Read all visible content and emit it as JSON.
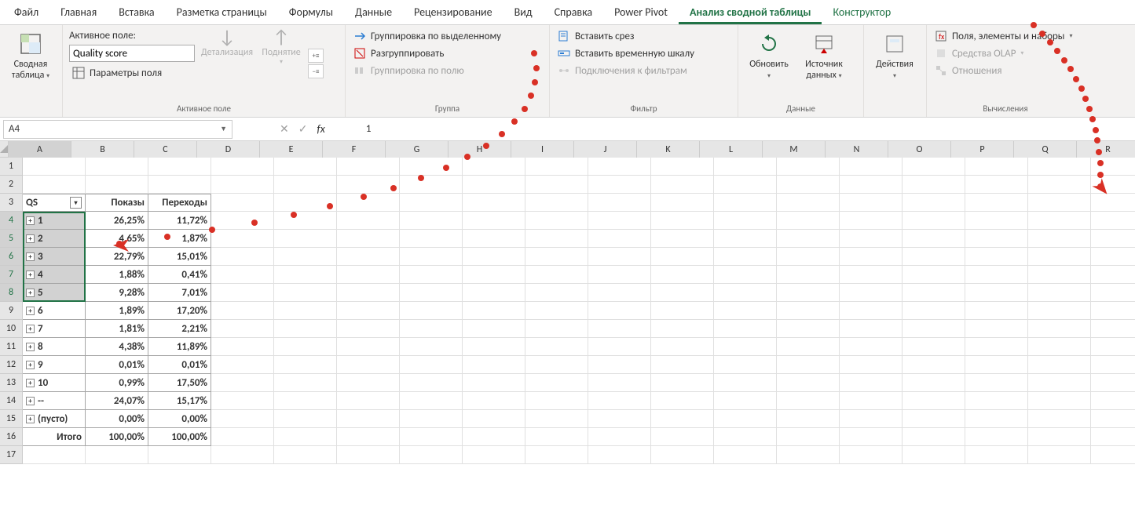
{
  "tabs": {
    "file": "Файл",
    "home": "Главная",
    "insert": "Вставка",
    "pagelayout": "Разметка страницы",
    "formulas": "Формулы",
    "data": "Данные",
    "review": "Рецензирование",
    "view": "Вид",
    "help": "Справка",
    "powerpivot": "Power Pivot",
    "analyze": "Анализ сводной таблицы",
    "design": "Конструктор"
  },
  "ribbon": {
    "pivottable": {
      "label": "Сводная",
      "label2": "таблица",
      "drop": "⌄"
    },
    "activefield": {
      "caption": "Активное поле:",
      "value": "Quality score",
      "params": "Параметры поля",
      "drilldown": "Детализация",
      "drillup": "Поднятие",
      "group_label": "Активное поле"
    },
    "group": {
      "bysel": "Группировка по выделенному",
      "ungroup": "Разгруппировать",
      "byfield": "Группировка по полю",
      "group_label": "Группа"
    },
    "filter": {
      "slicer": "Вставить срез",
      "timeline": "Вставить временную шкалу",
      "connections": "Подключения к фильтрам",
      "group_label": "Фильтр"
    },
    "data": {
      "refresh": "Обновить",
      "source": "Источник",
      "source2": "данных",
      "group_label": "Данные"
    },
    "actions": {
      "label": "Действия",
      "group_label": ""
    },
    "calc": {
      "fields": "Поля, элементы и наборы",
      "olap": "Средства OLAP",
      "relations": "Отношения",
      "group_label": "Вычисления"
    }
  },
  "namebox": "A4",
  "formula": "1",
  "columns": [
    "A",
    "B",
    "C",
    "D",
    "E",
    "F",
    "G",
    "H",
    "I",
    "J",
    "K",
    "L",
    "M",
    "N",
    "O",
    "P",
    "Q",
    "R"
  ],
  "pivot": {
    "header": {
      "qs": "QS",
      "a": "Показы",
      "b": "Переходы"
    },
    "rows": [
      {
        "k": "1",
        "a": "26,25%",
        "b": "11,72%",
        "sel": true
      },
      {
        "k": "2",
        "a": "4,65%",
        "b": "1,87%",
        "sel": true
      },
      {
        "k": "3",
        "a": "22,79%",
        "b": "15,01%",
        "sel": true
      },
      {
        "k": "4",
        "a": "1,88%",
        "b": "0,41%",
        "sel": true
      },
      {
        "k": "5",
        "a": "9,28%",
        "b": "7,01%",
        "sel": true
      },
      {
        "k": "6",
        "a": "1,89%",
        "b": "17,20%",
        "sel": false
      },
      {
        "k": "7",
        "a": "1,81%",
        "b": "2,21%",
        "sel": false
      },
      {
        "k": "8",
        "a": "4,38%",
        "b": "11,89%",
        "sel": false
      },
      {
        "k": "9",
        "a": "0,01%",
        "b": "0,01%",
        "sel": false
      },
      {
        "k": "10",
        "a": "0,99%",
        "b": "17,50%",
        "sel": false
      },
      {
        "k": "--",
        "a": "24,07%",
        "b": "15,17%",
        "sel": false
      },
      {
        "k": "(пусто)",
        "a": "0,00%",
        "b": "0,00%",
        "sel": false
      }
    ],
    "total": {
      "label": "Итого",
      "a": "100,00%",
      "b": "100,00%"
    }
  },
  "rownums": [
    "1",
    "2",
    "3",
    "4",
    "5",
    "6",
    "7",
    "8",
    "9",
    "10",
    "11",
    "12",
    "13",
    "14",
    "15",
    "16",
    "17"
  ]
}
